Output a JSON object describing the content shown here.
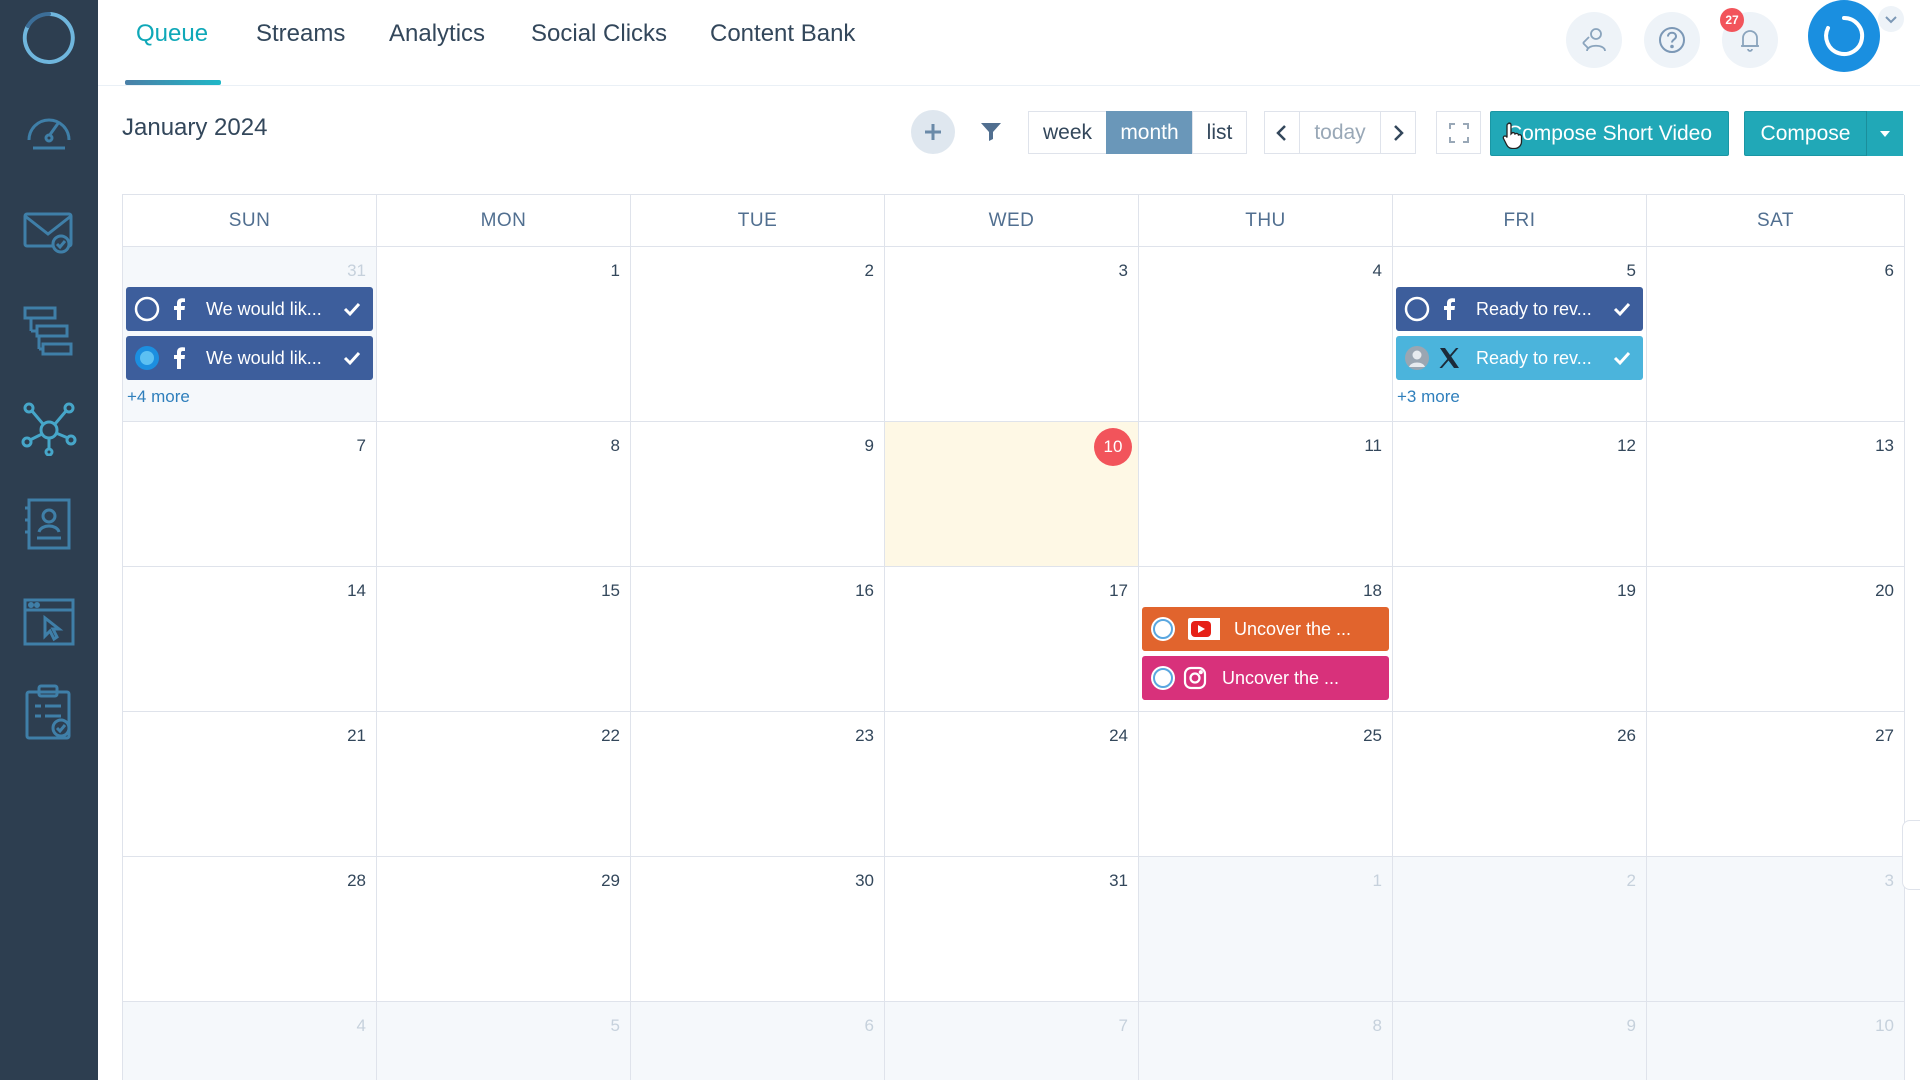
{
  "nav": {
    "tabs": [
      {
        "label": "Queue",
        "active": true
      },
      {
        "label": "Streams",
        "active": false
      },
      {
        "label": "Analytics",
        "active": false
      },
      {
        "label": "Social Clicks",
        "active": false
      },
      {
        "label": "Content Bank",
        "active": false
      }
    ],
    "notification_count": "27",
    "accent_color": "#0fa8b8"
  },
  "sidebar": {
    "icons": [
      "logo-ring-icon",
      "dashboard-gauge-icon",
      "mail-check-icon",
      "workflow-icon",
      "social-network-icon",
      "contact-card-icon",
      "browser-pointer-icon",
      "clipboard-check-icon"
    ]
  },
  "toolbar": {
    "month_title": "January 2024",
    "view_week": "week",
    "view_month": "month",
    "view_list": "list",
    "today_label": "today",
    "compose_short_video": "Compose Short Video",
    "compose": "Compose"
  },
  "calendar": {
    "weekdays": [
      "SUN",
      "MON",
      "TUE",
      "WED",
      "THU",
      "FRI",
      "SAT"
    ],
    "weeks": [
      [
        {
          "d": "31",
          "other": true
        },
        {
          "d": "1"
        },
        {
          "d": "2"
        },
        {
          "d": "3"
        },
        {
          "d": "4"
        },
        {
          "d": "5"
        },
        {
          "d": "6"
        }
      ],
      [
        {
          "d": "7"
        },
        {
          "d": "8"
        },
        {
          "d": "9"
        },
        {
          "d": "10",
          "today": true
        },
        {
          "d": "11"
        },
        {
          "d": "12"
        },
        {
          "d": "13"
        }
      ],
      [
        {
          "d": "14"
        },
        {
          "d": "15"
        },
        {
          "d": "16"
        },
        {
          "d": "17"
        },
        {
          "d": "18"
        },
        {
          "d": "19"
        },
        {
          "d": "20"
        }
      ],
      [
        {
          "d": "21"
        },
        {
          "d": "22"
        },
        {
          "d": "23"
        },
        {
          "d": "24"
        },
        {
          "d": "25"
        },
        {
          "d": "26"
        },
        {
          "d": "27"
        }
      ],
      [
        {
          "d": "28"
        },
        {
          "d": "29"
        },
        {
          "d": "30"
        },
        {
          "d": "31"
        },
        {
          "d": "1",
          "other": true
        },
        {
          "d": "2",
          "other": true
        },
        {
          "d": "3",
          "other": true
        }
      ],
      [
        {
          "d": "4",
          "other": true
        },
        {
          "d": "5",
          "other": true
        },
        {
          "d": "6",
          "other": true
        },
        {
          "d": "7",
          "other": true
        },
        {
          "d": "8",
          "other": true
        },
        {
          "d": "9",
          "other": true
        },
        {
          "d": "10",
          "other": true
        }
      ]
    ],
    "events": {
      "w0d0": [
        {
          "text": "We would lik...",
          "network": "facebook",
          "checked": true
        },
        {
          "text": "We would lik...",
          "network": "facebook",
          "checked": true
        }
      ],
      "w0d5": [
        {
          "text": "Ready to rev...",
          "network": "facebook",
          "checked": true
        },
        {
          "text": "Ready to rev...",
          "network": "x",
          "checked": true
        }
      ],
      "w2d4": [
        {
          "text": "Uncover the ...",
          "network": "youtube",
          "checked": false
        },
        {
          "text": "Uncover the ...",
          "network": "instagram",
          "checked": false
        }
      ]
    },
    "more_links": {
      "w0d0": "+4 more",
      "w0d5": "+3 more"
    }
  }
}
